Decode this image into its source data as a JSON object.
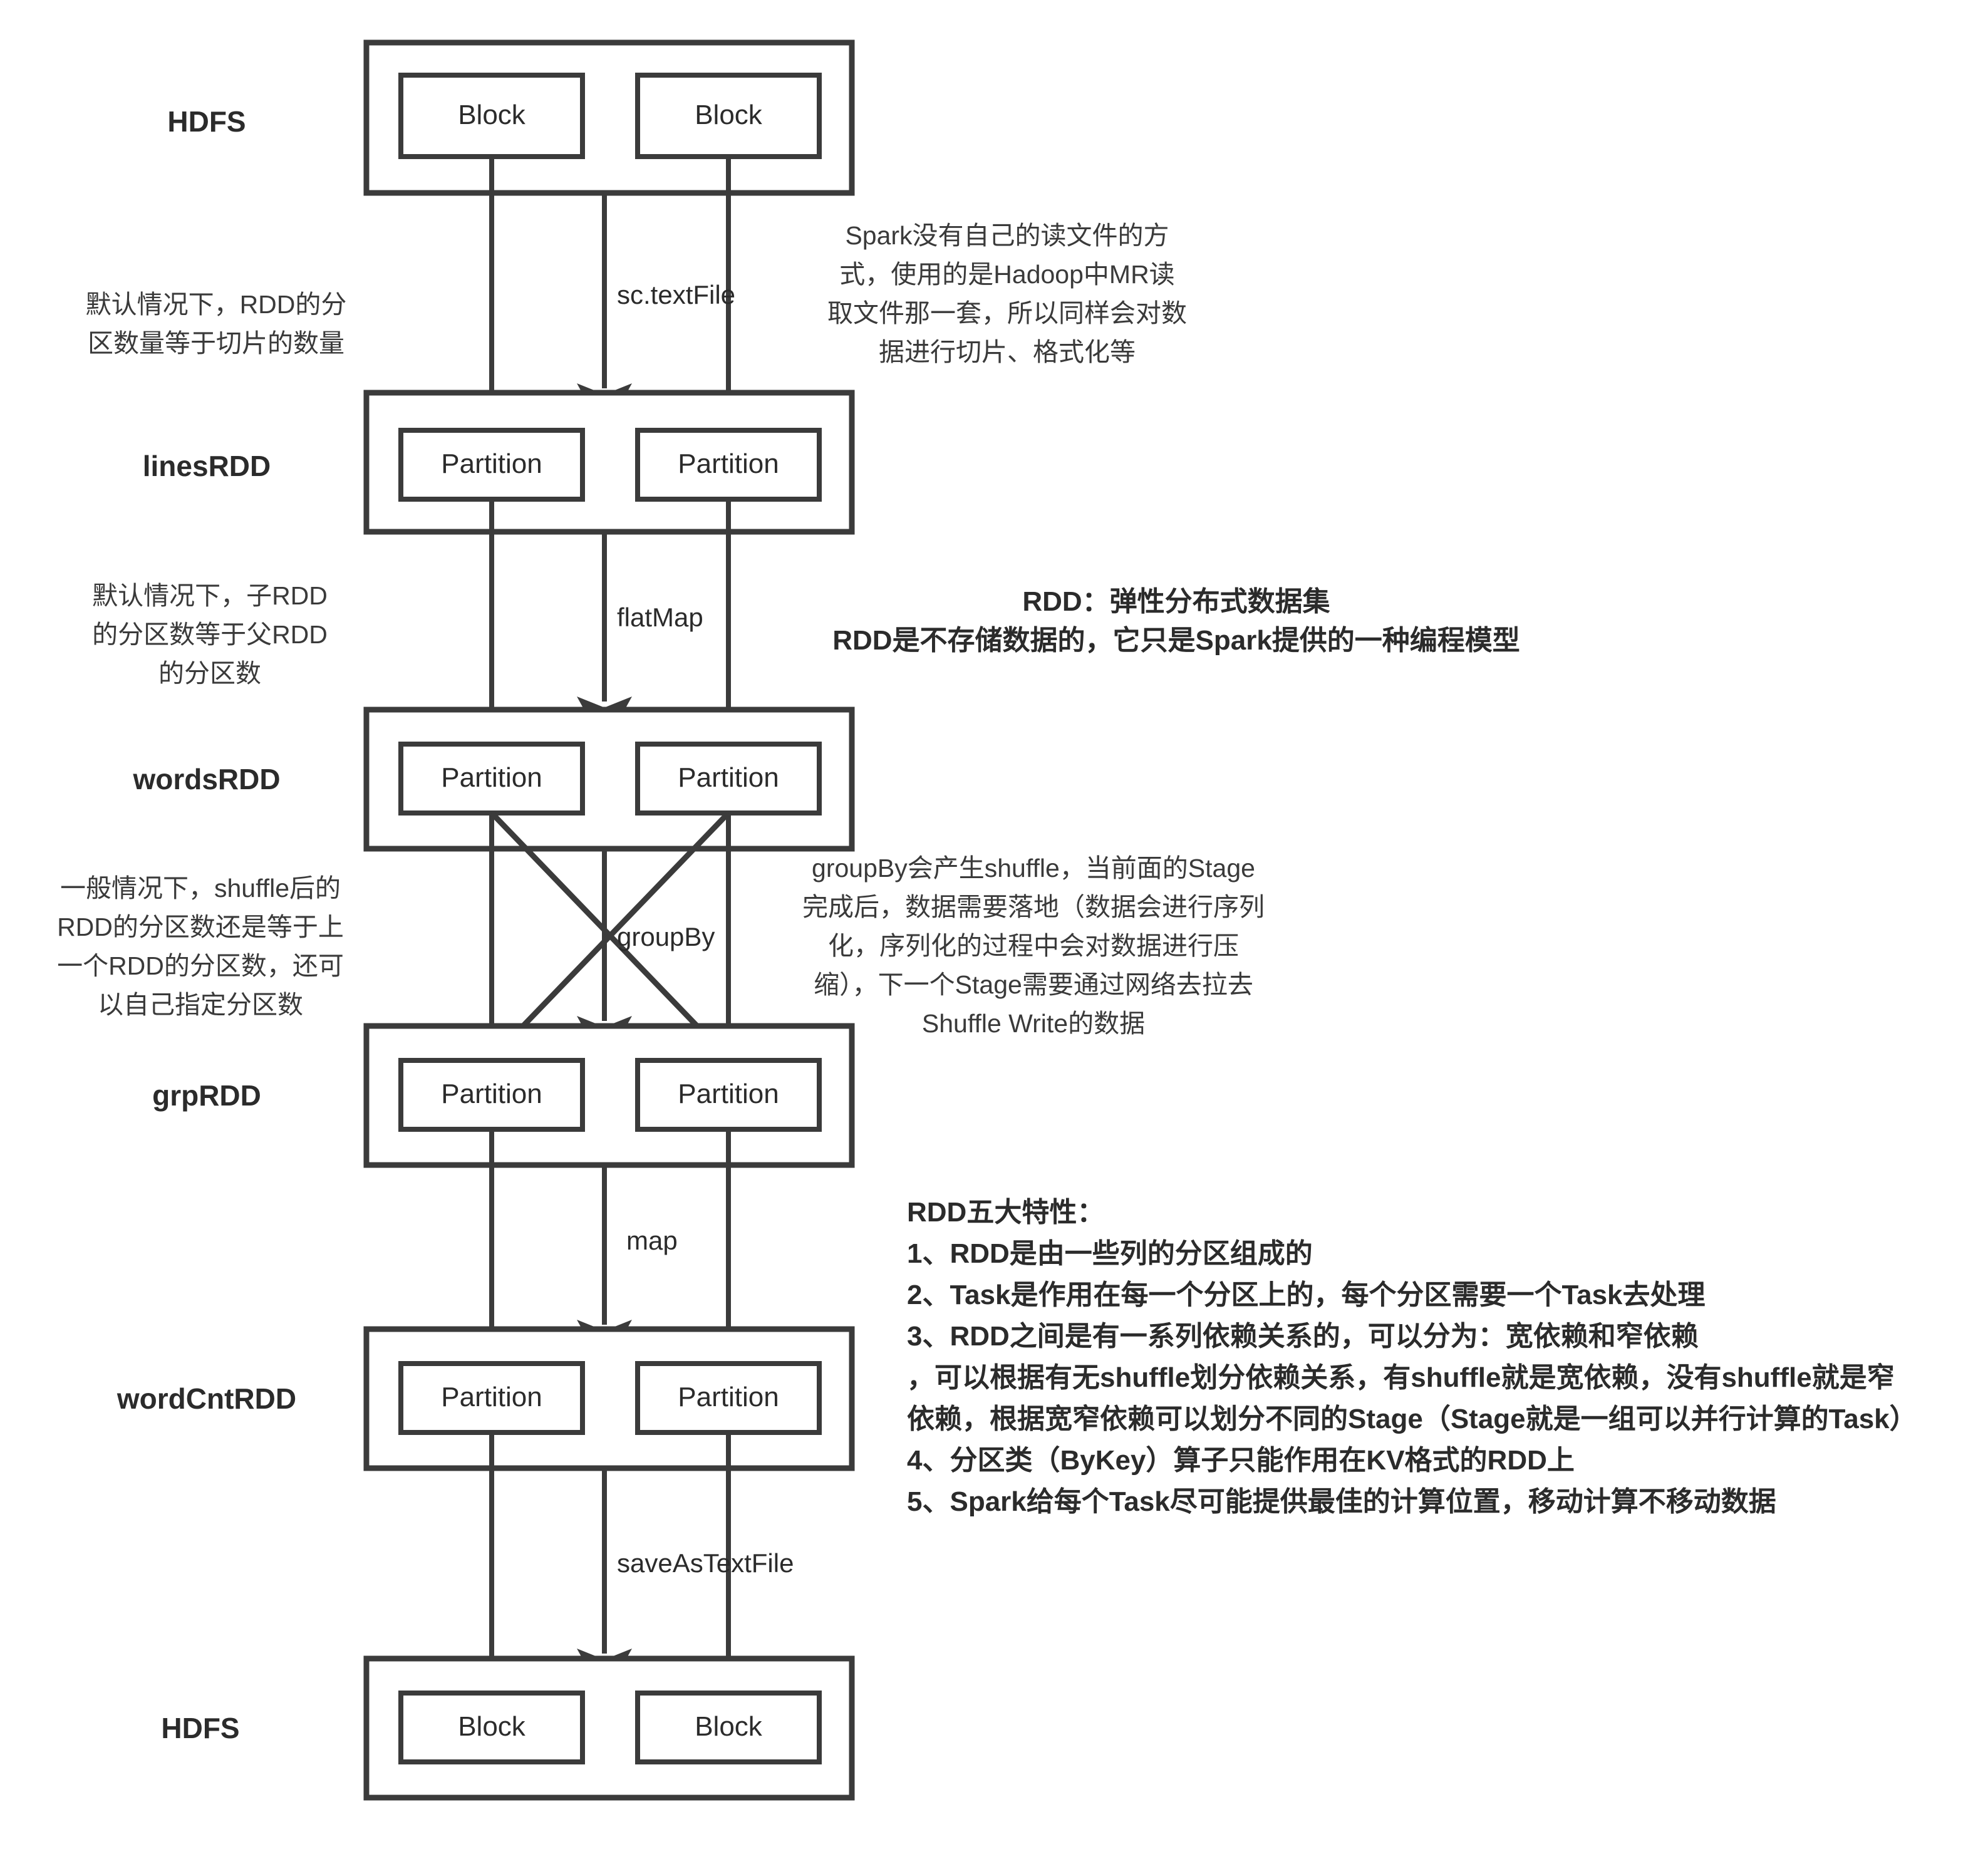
{
  "diagram": {
    "title": "Spark RDD WordCount Lineage Diagram",
    "rows": [
      {
        "id": "hdfs-source",
        "label": "HDFS",
        "box_label": "Block",
        "boxes": [
          "Block",
          "Block"
        ]
      },
      {
        "id": "linesRDD",
        "label": "linesRDD",
        "box_label": "Partition",
        "boxes": [
          "Partition",
          "Partition"
        ]
      },
      {
        "id": "wordsRDD",
        "label": "wordsRDD",
        "box_label": "Partition",
        "boxes": [
          "Partition",
          "Partition"
        ]
      },
      {
        "id": "grpRDD",
        "label": "grpRDD",
        "box_label": "Partition",
        "boxes": [
          "Partition",
          "Partition"
        ]
      },
      {
        "id": "wordCntRDD",
        "label": "wordCntRDD",
        "box_label": "Partition",
        "boxes": [
          "Partition",
          "Partition"
        ]
      },
      {
        "id": "hdfs-sink",
        "label": "HDFS",
        "box_label": "Block",
        "boxes": [
          "Block",
          "Block"
        ]
      }
    ],
    "edges": [
      {
        "id": "edge-sc-textfile",
        "label": "sc.textFile",
        "from": "hdfs-source",
        "to": "linesRDD",
        "shuffle": false
      },
      {
        "id": "edge-flatmap",
        "label": "flatMap",
        "from": "linesRDD",
        "to": "wordsRDD",
        "shuffle": false
      },
      {
        "id": "edge-groupby",
        "label": "groupBy",
        "from": "wordsRDD",
        "to": "grpRDD",
        "shuffle": true
      },
      {
        "id": "edge-map",
        "label": "map",
        "from": "grpRDD",
        "to": "wordCntRDD",
        "shuffle": false
      },
      {
        "id": "edge-saveastextfile",
        "label": "saveAsTextFile",
        "from": "wordCntRDD",
        "to": "hdfs-sink",
        "shuffle": false
      }
    ],
    "notes": {
      "left_partition_count": [
        "默认情况下，RDD的分",
        "区数量等于切片的数量"
      ],
      "left_child_partition": [
        "默认情况下，子RDD",
        "的分区数等于父RDD",
        "的分区数"
      ],
      "left_shuffle_partition": [
        "一般情况下，shuffle后的",
        "RDD的分区数还是等于上",
        "一个RDD的分区数，还可",
        "以自己指定分区数"
      ],
      "right_read_file": [
        "Spark没有自己的读文件的方",
        "式，使用的是Hadoop中MR读",
        "取文件那一套，所以同样会对数",
        "据进行切片、格式化等"
      ],
      "right_rdd_definition": [
        "RDD：弹性分布式数据集",
        "RDD是不存储数据的，它只是Spark提供的一种编程模型"
      ],
      "right_groupby_shuffle": [
        "groupBy会产生shuffle，当前面的Stage",
        "完成后，数据需要落地（数据会进行序列",
        "化，序列化的过程中会对数据进行压",
        "缩），下一个Stage需要通过网络去拉去",
        "Shuffle Write的数据"
      ],
      "right_five_features_title": "RDD五大特性：",
      "right_five_features": [
        "1、RDD是由一些列的分区组成的",
        "2、Task是作用在每一个分区上的，每个分区需要一个Task去处理",
        "3、RDD之间是有一系列依赖关系的，可以分为：宽依赖和窄依赖",
        "，可以根据有无shuffle划分依赖关系，有shuffle就是宽依赖，没有shuffle就是窄",
        "依赖，根据宽窄依赖可以划分不同的Stage（Stage就是一组可以并行计算的Task）",
        "4、分区类（ByKey）算子只能作用在KV格式的RDD上",
        "5、Spark给每个Task尽可能提供最佳的计算位置，移动计算不移动数据"
      ]
    },
    "colors": {
      "stroke": "#3b3b3b",
      "text": "#2b2b2b",
      "note_text": "#3a3a3a",
      "background": "#ffffff"
    }
  }
}
